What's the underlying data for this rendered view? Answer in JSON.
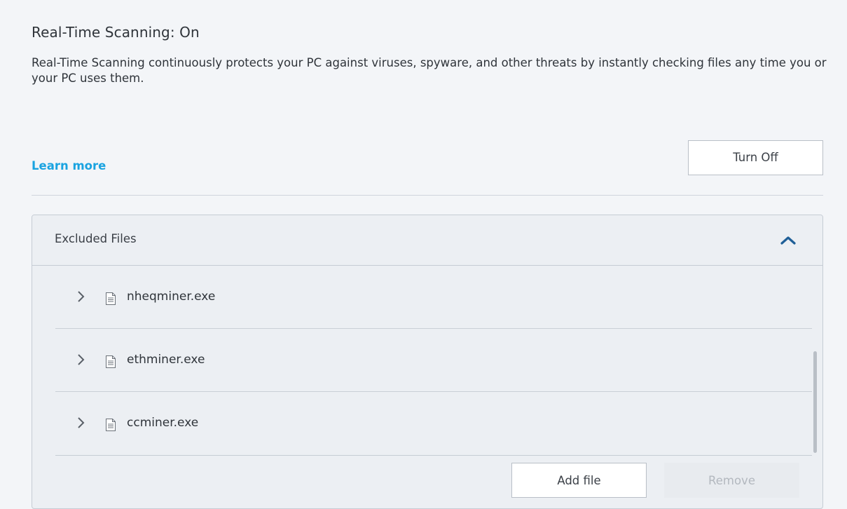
{
  "scanning": {
    "title": "Real-Time Scanning: On",
    "description": "Real-Time Scanning continuously protects your PC against viruses, spyware, and other threats by instantly checking files any time you or your PC uses them.",
    "learn_more_label": "Learn more",
    "turn_off_label": "Turn Off"
  },
  "excluded_files": {
    "header_label": "Excluded Files",
    "expanded": true,
    "items": [
      {
        "name": "nheqminer.exe",
        "icon": "file-icon"
      },
      {
        "name": "ethminer.exe",
        "icon": "file-icon"
      },
      {
        "name": "ccminer.exe",
        "icon": "file-icon"
      }
    ],
    "add_file_label": "Add file",
    "remove_label": "Remove",
    "remove_enabled": false
  },
  "colors": {
    "link": "#1aa3e0",
    "collapse_chevron": "#1f5f97",
    "background": "#f3f5f8",
    "panel_background": "#eceff3"
  }
}
